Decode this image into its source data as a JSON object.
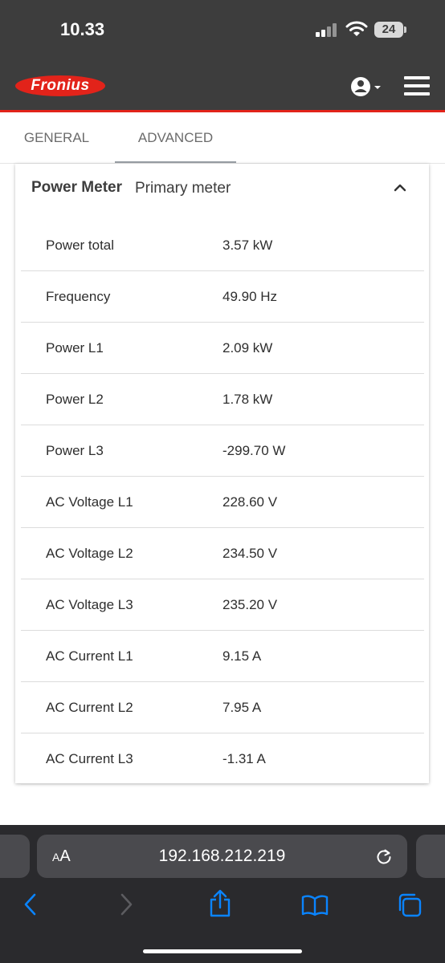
{
  "status_bar": {
    "time": "10.33",
    "battery": "24"
  },
  "header": {
    "logo_text": "Fronius"
  },
  "tabs": [
    {
      "label": "GENERAL"
    },
    {
      "label": "ADVANCED"
    }
  ],
  "card": {
    "title": "Power Meter",
    "subtitle": "Primary meter",
    "rows": [
      {
        "label": "Power total",
        "value": "3.57 kW"
      },
      {
        "label": "Frequency",
        "value": "49.90 Hz"
      },
      {
        "label": "Power L1",
        "value": "2.09 kW"
      },
      {
        "label": "Power L2",
        "value": "1.78 kW"
      },
      {
        "label": "Power L3",
        "value": "-299.70 W"
      },
      {
        "label": "AC Voltage L1",
        "value": "228.60 V"
      },
      {
        "label": "AC Voltage L2",
        "value": "234.50 V"
      },
      {
        "label": "AC Voltage L3",
        "value": "235.20 V"
      },
      {
        "label": "AC Current L1",
        "value": "9.15 A"
      },
      {
        "label": "AC Current L2",
        "value": "7.95 A"
      },
      {
        "label": "AC Current L3",
        "value": "-1.31 A"
      }
    ]
  },
  "browser": {
    "aa_small": "A",
    "aa_large": "A",
    "url": "192.168.212.219"
  },
  "colors": {
    "header_bg": "#3d3d3d",
    "brand_red": "#e2231a",
    "ios_blue": "#0a84ff"
  },
  "icons": [
    "signal-icon",
    "wifi-icon",
    "battery-icon",
    "user-icon",
    "hamburger-icon",
    "chevron-up-icon",
    "reload-icon",
    "back-icon",
    "forward-icon",
    "share-icon",
    "bookmarks-icon",
    "tabs-icon"
  ]
}
